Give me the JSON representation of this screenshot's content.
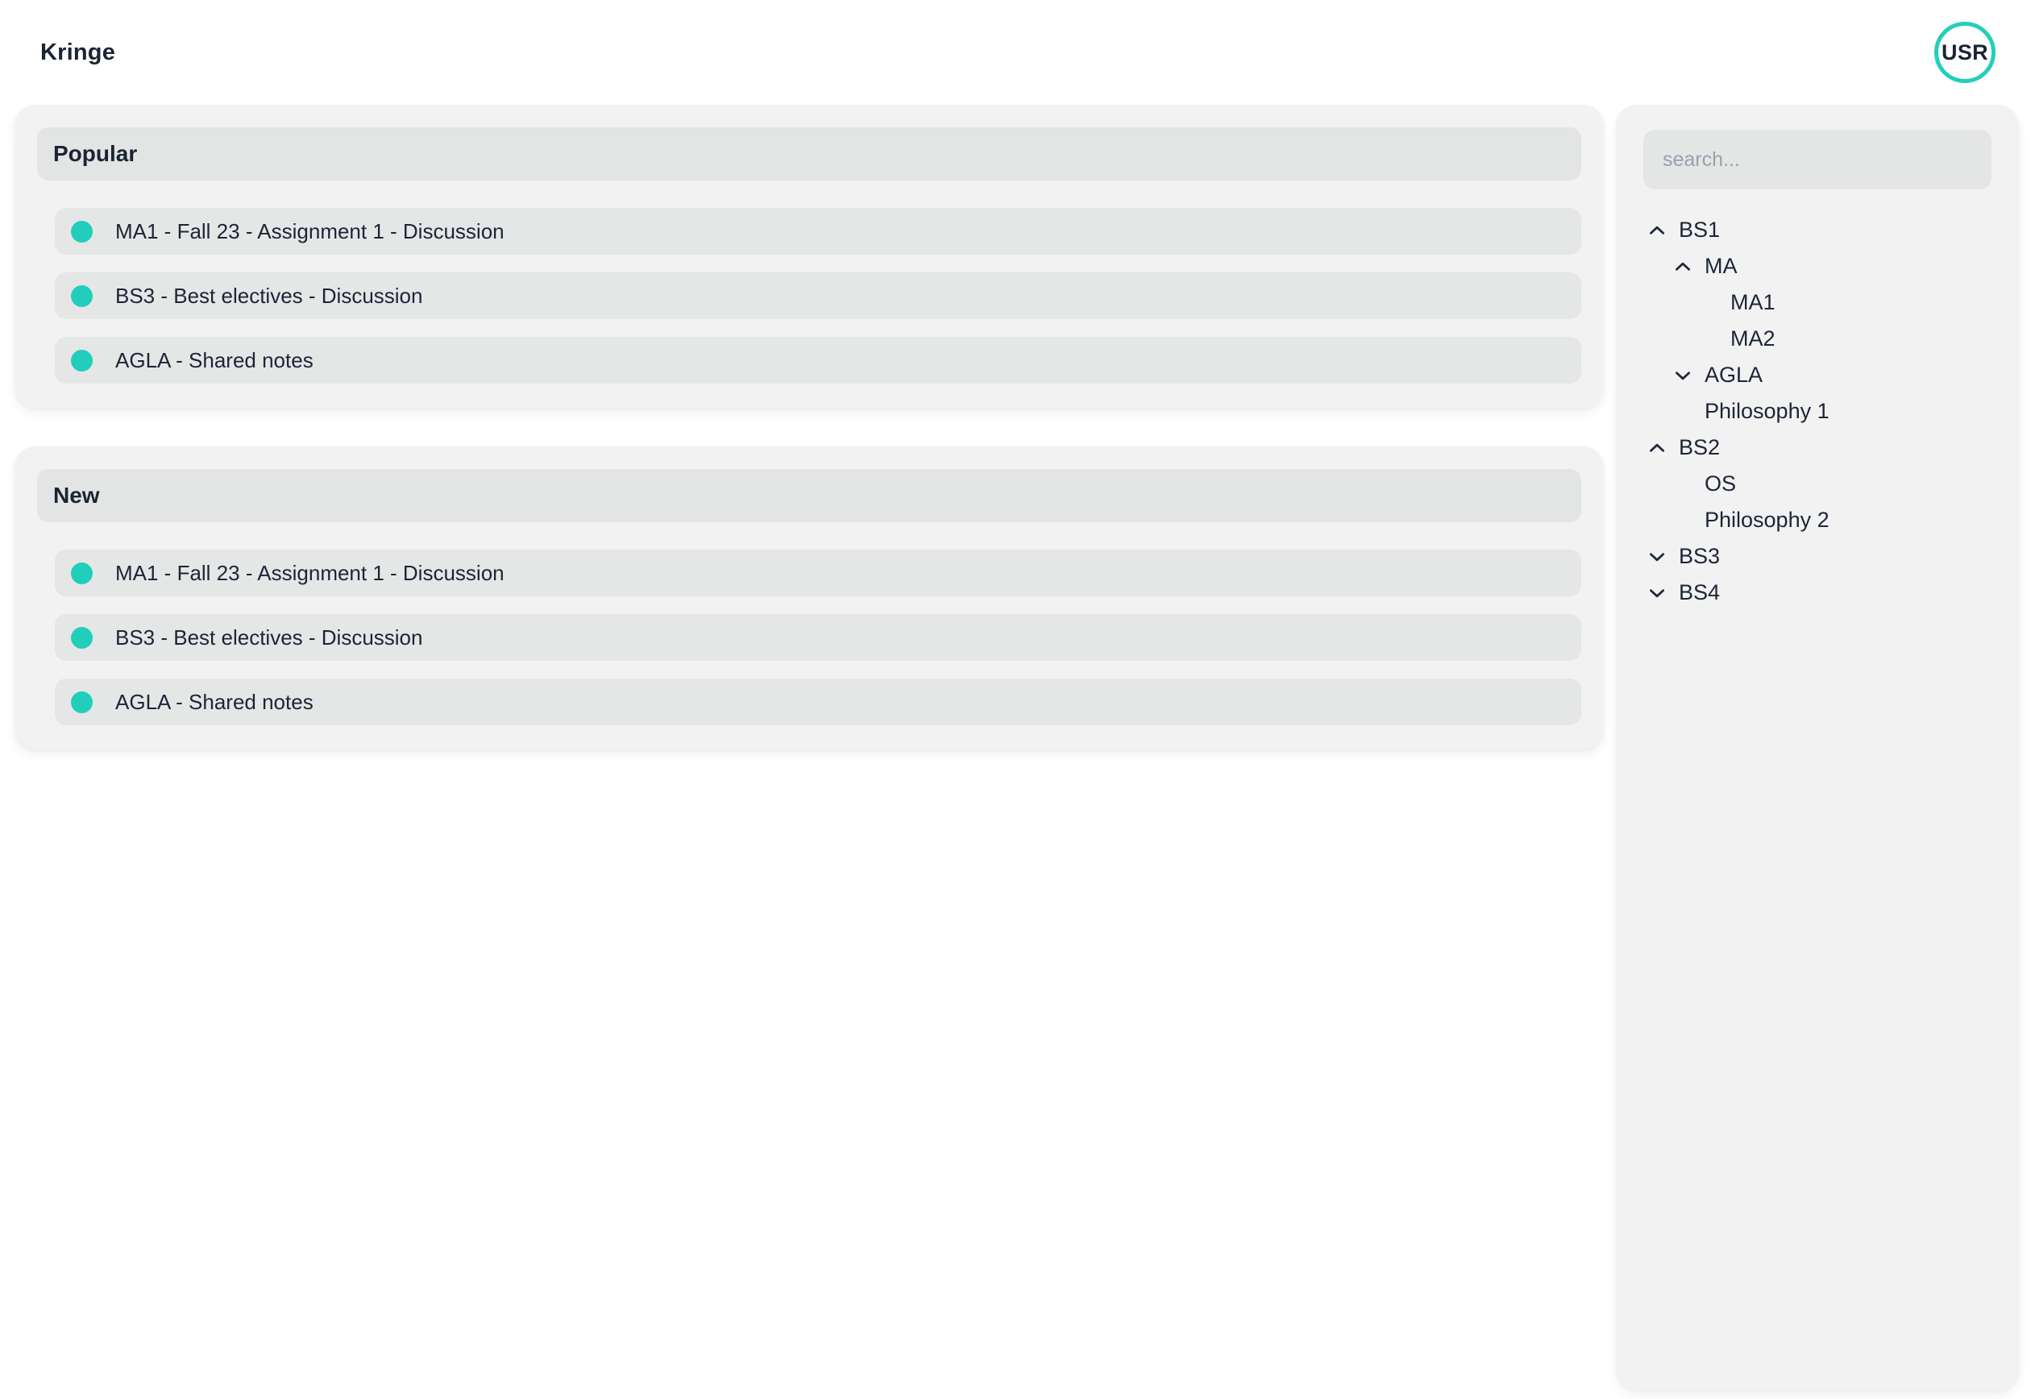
{
  "app": {
    "brand": "Kringe",
    "accent_color": "#20cebb",
    "text_color": "#1c2536",
    "card_bg": "#f2f2f2",
    "panel_bg": "#e4e5e5"
  },
  "topbar": {
    "title": "Kringe",
    "avatar_label": "USR"
  },
  "sections": [
    {
      "title": "Popular",
      "items": [
        {
          "label": "MA1 - Fall 23 - Assignment 1 - Discussion",
          "dot": "status-dot"
        },
        {
          "label": "BS3 - Best electives - Discussion",
          "dot": "status-dot"
        },
        {
          "label": "AGLA - Shared notes",
          "dot": "status-dot"
        }
      ]
    },
    {
      "title": "New",
      "items": [
        {
          "label": "MA1 - Fall 23 - Assignment 1 - Discussion",
          "dot": "status-dot"
        },
        {
          "label": "BS3 - Best electives - Discussion",
          "dot": "status-dot"
        },
        {
          "label": "AGLA - Shared notes",
          "dot": "status-dot"
        }
      ]
    }
  ],
  "sidebar": {
    "search": {
      "placeholder": "search...",
      "value": ""
    },
    "tree": [
      {
        "label": "BS1",
        "level": 0,
        "icon": "chevron-up-icon",
        "expanded": true
      },
      {
        "label": "MA",
        "level": 1,
        "icon": "chevron-up-icon",
        "expanded": true
      },
      {
        "label": "MA1",
        "level": 2,
        "icon": "none",
        "expanded": false
      },
      {
        "label": "MA2",
        "level": 2,
        "icon": "none",
        "expanded": false
      },
      {
        "label": "AGLA",
        "level": 1,
        "icon": "chevron-down-icon",
        "expanded": false
      },
      {
        "label": "Philosophy 1",
        "level": 1,
        "icon": "none",
        "expanded": false
      },
      {
        "label": "BS2",
        "level": 0,
        "icon": "chevron-up-icon",
        "expanded": true
      },
      {
        "label": "OS",
        "level": 1,
        "icon": "none",
        "expanded": false
      },
      {
        "label": "Philosophy 2",
        "level": 1,
        "icon": "none",
        "expanded": false
      },
      {
        "label": "BS3",
        "level": 0,
        "icon": "chevron-down-icon",
        "expanded": false
      },
      {
        "label": "BS4",
        "level": 0,
        "icon": "chevron-down-icon",
        "expanded": false
      }
    ]
  }
}
